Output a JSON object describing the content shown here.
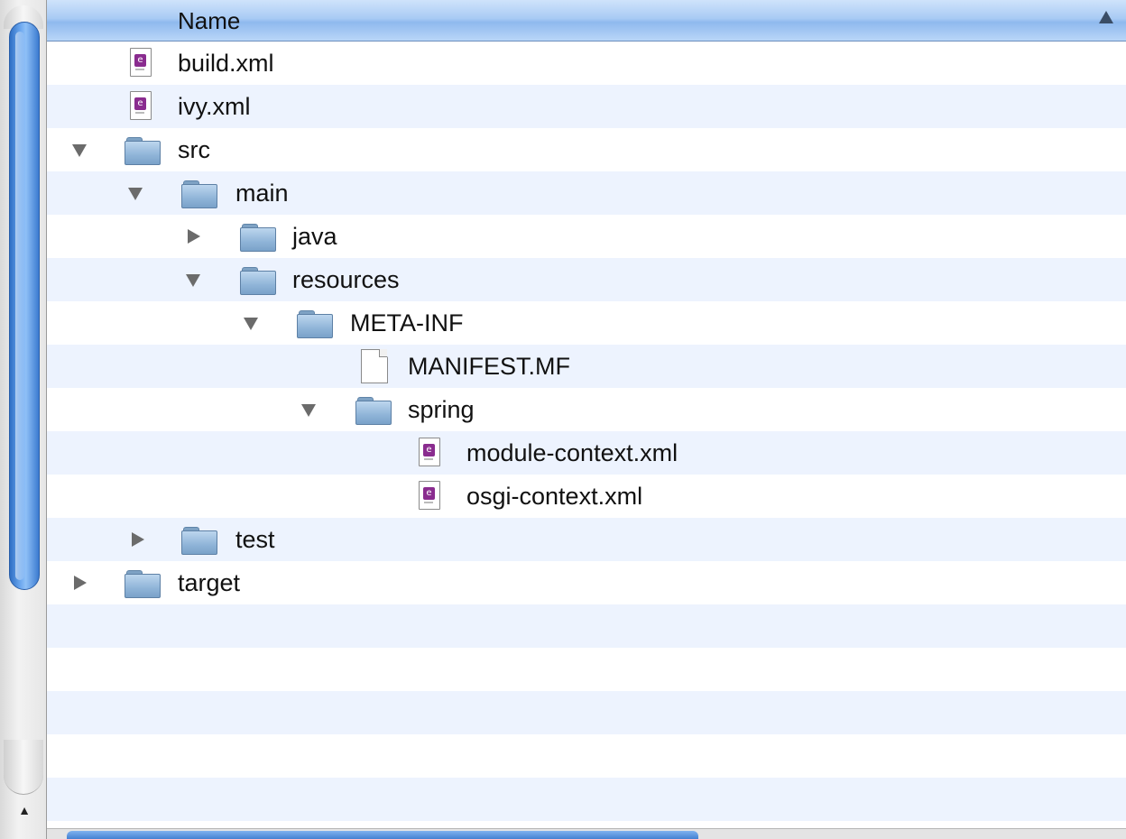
{
  "header": {
    "column_name": "Name"
  },
  "rows": [
    {
      "label": "build.xml",
      "icon": "xml-file-icon",
      "disclosure": "none"
    },
    {
      "label": "ivy.xml",
      "icon": "xml-file-icon",
      "disclosure": "none"
    },
    {
      "label": "src",
      "icon": "folder-icon",
      "disclosure": "expanded"
    },
    {
      "label": "main",
      "icon": "folder-icon",
      "disclosure": "expanded"
    },
    {
      "label": "java",
      "icon": "folder-icon",
      "disclosure": "collapsed"
    },
    {
      "label": "resources",
      "icon": "folder-icon",
      "disclosure": "expanded"
    },
    {
      "label": "META-INF",
      "icon": "folder-icon",
      "disclosure": "expanded"
    },
    {
      "label": "MANIFEST.MF",
      "icon": "document-icon",
      "disclosure": "none"
    },
    {
      "label": "spring",
      "icon": "folder-icon",
      "disclosure": "expanded"
    },
    {
      "label": "module-context.xml",
      "icon": "xml-file-icon",
      "disclosure": "none"
    },
    {
      "label": "osgi-context.xml",
      "icon": "xml-file-icon",
      "disclosure": "none"
    },
    {
      "label": "test",
      "icon": "folder-icon",
      "disclosure": "collapsed"
    },
    {
      "label": "target",
      "icon": "folder-icon",
      "disclosure": "collapsed"
    }
  ],
  "colors": {
    "header": "#a9cbf4",
    "stripe": "#edf3fe",
    "scroll_thumb": "#5b96e0"
  }
}
